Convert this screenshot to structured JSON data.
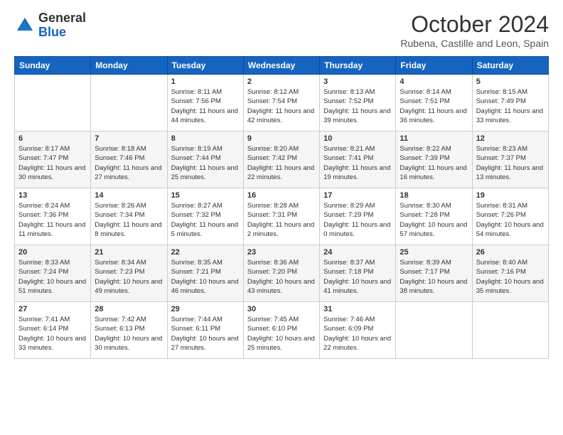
{
  "logo": {
    "general": "General",
    "blue": "Blue"
  },
  "title": "October 2024",
  "subtitle": "Rubena, Castille and Leon, Spain",
  "days_of_week": [
    "Sunday",
    "Monday",
    "Tuesday",
    "Wednesday",
    "Thursday",
    "Friday",
    "Saturday"
  ],
  "weeks": [
    [
      {
        "day": "",
        "info": ""
      },
      {
        "day": "",
        "info": ""
      },
      {
        "day": "1",
        "info": "Sunrise: 8:11 AM\nSunset: 7:56 PM\nDaylight: 11 hours and 44 minutes."
      },
      {
        "day": "2",
        "info": "Sunrise: 8:12 AM\nSunset: 7:54 PM\nDaylight: 11 hours and 42 minutes."
      },
      {
        "day": "3",
        "info": "Sunrise: 8:13 AM\nSunset: 7:52 PM\nDaylight: 11 hours and 39 minutes."
      },
      {
        "day": "4",
        "info": "Sunrise: 8:14 AM\nSunset: 7:51 PM\nDaylight: 11 hours and 36 minutes."
      },
      {
        "day": "5",
        "info": "Sunrise: 8:15 AM\nSunset: 7:49 PM\nDaylight: 11 hours and 33 minutes."
      }
    ],
    [
      {
        "day": "6",
        "info": "Sunrise: 8:17 AM\nSunset: 7:47 PM\nDaylight: 11 hours and 30 minutes."
      },
      {
        "day": "7",
        "info": "Sunrise: 8:18 AM\nSunset: 7:46 PM\nDaylight: 11 hours and 27 minutes."
      },
      {
        "day": "8",
        "info": "Sunrise: 8:19 AM\nSunset: 7:44 PM\nDaylight: 11 hours and 25 minutes."
      },
      {
        "day": "9",
        "info": "Sunrise: 8:20 AM\nSunset: 7:42 PM\nDaylight: 11 hours and 22 minutes."
      },
      {
        "day": "10",
        "info": "Sunrise: 8:21 AM\nSunset: 7:41 PM\nDaylight: 11 hours and 19 minutes."
      },
      {
        "day": "11",
        "info": "Sunrise: 8:22 AM\nSunset: 7:39 PM\nDaylight: 11 hours and 16 minutes."
      },
      {
        "day": "12",
        "info": "Sunrise: 8:23 AM\nSunset: 7:37 PM\nDaylight: 11 hours and 13 minutes."
      }
    ],
    [
      {
        "day": "13",
        "info": "Sunrise: 8:24 AM\nSunset: 7:36 PM\nDaylight: 11 hours and 11 minutes."
      },
      {
        "day": "14",
        "info": "Sunrise: 8:26 AM\nSunset: 7:34 PM\nDaylight: 11 hours and 8 minutes."
      },
      {
        "day": "15",
        "info": "Sunrise: 8:27 AM\nSunset: 7:32 PM\nDaylight: 11 hours and 5 minutes."
      },
      {
        "day": "16",
        "info": "Sunrise: 8:28 AM\nSunset: 7:31 PM\nDaylight: 11 hours and 2 minutes."
      },
      {
        "day": "17",
        "info": "Sunrise: 8:29 AM\nSunset: 7:29 PM\nDaylight: 11 hours and 0 minutes."
      },
      {
        "day": "18",
        "info": "Sunrise: 8:30 AM\nSunset: 7:28 PM\nDaylight: 10 hours and 57 minutes."
      },
      {
        "day": "19",
        "info": "Sunrise: 8:31 AM\nSunset: 7:26 PM\nDaylight: 10 hours and 54 minutes."
      }
    ],
    [
      {
        "day": "20",
        "info": "Sunrise: 8:33 AM\nSunset: 7:24 PM\nDaylight: 10 hours and 51 minutes."
      },
      {
        "day": "21",
        "info": "Sunrise: 8:34 AM\nSunset: 7:23 PM\nDaylight: 10 hours and 49 minutes."
      },
      {
        "day": "22",
        "info": "Sunrise: 8:35 AM\nSunset: 7:21 PM\nDaylight: 10 hours and 46 minutes."
      },
      {
        "day": "23",
        "info": "Sunrise: 8:36 AM\nSunset: 7:20 PM\nDaylight: 10 hours and 43 minutes."
      },
      {
        "day": "24",
        "info": "Sunrise: 8:37 AM\nSunset: 7:18 PM\nDaylight: 10 hours and 41 minutes."
      },
      {
        "day": "25",
        "info": "Sunrise: 8:39 AM\nSunset: 7:17 PM\nDaylight: 10 hours and 38 minutes."
      },
      {
        "day": "26",
        "info": "Sunrise: 8:40 AM\nSunset: 7:16 PM\nDaylight: 10 hours and 35 minutes."
      }
    ],
    [
      {
        "day": "27",
        "info": "Sunrise: 7:41 AM\nSunset: 6:14 PM\nDaylight: 10 hours and 33 minutes."
      },
      {
        "day": "28",
        "info": "Sunrise: 7:42 AM\nSunset: 6:13 PM\nDaylight: 10 hours and 30 minutes."
      },
      {
        "day": "29",
        "info": "Sunrise: 7:44 AM\nSunset: 6:11 PM\nDaylight: 10 hours and 27 minutes."
      },
      {
        "day": "30",
        "info": "Sunrise: 7:45 AM\nSunset: 6:10 PM\nDaylight: 10 hours and 25 minutes."
      },
      {
        "day": "31",
        "info": "Sunrise: 7:46 AM\nSunset: 6:09 PM\nDaylight: 10 hours and 22 minutes."
      },
      {
        "day": "",
        "info": ""
      },
      {
        "day": "",
        "info": ""
      }
    ]
  ]
}
